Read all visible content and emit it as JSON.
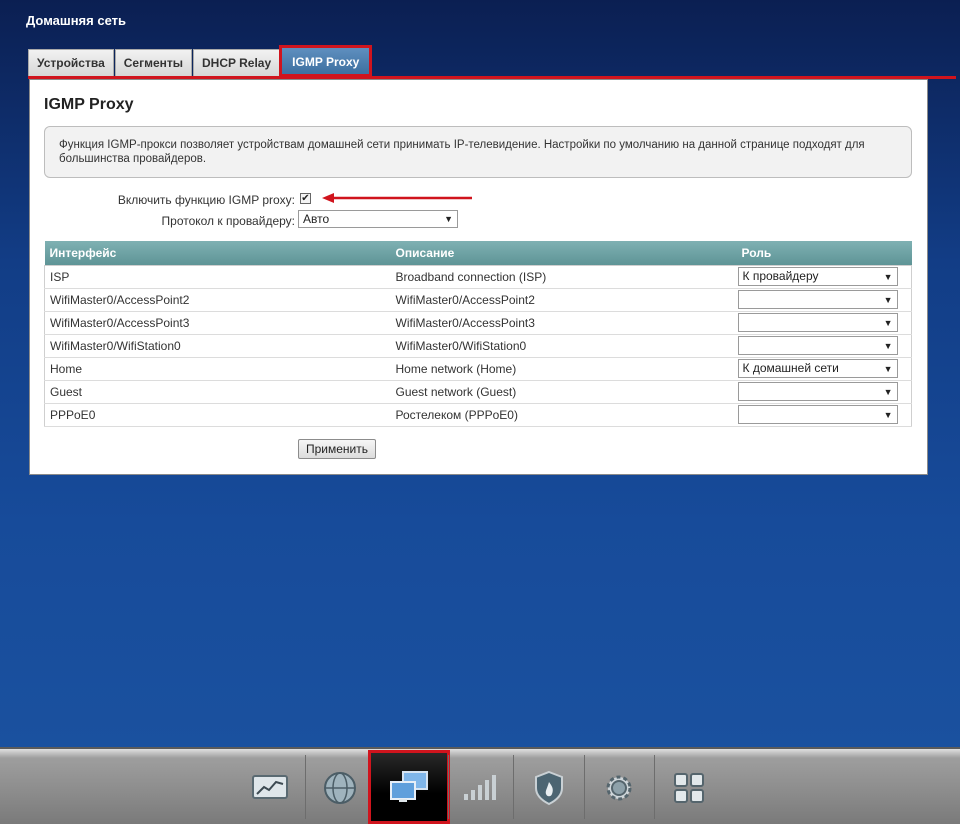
{
  "header": {
    "title": "Домашняя сеть"
  },
  "tabs": [
    {
      "label": "Устройства"
    },
    {
      "label": "Сегменты"
    },
    {
      "label": "DHCP Relay"
    },
    {
      "label": "IGMP Proxy",
      "active": true
    }
  ],
  "panel": {
    "title": "IGMP Proxy",
    "info": "Функция IGMP-прокси позволяет устройствам домашней сети принимать IP-телевидение. Настройки по умолчанию на данной странице подходят для большинства провайдеров.",
    "enable_label": "Включить функцию IGMP proxy:",
    "enable_checked": true,
    "protocol_label": "Протокол к провайдеру:",
    "protocol_value": "Авто",
    "apply_label": "Применить"
  },
  "table": {
    "headers": [
      "Интерфейс",
      "Описание",
      "Роль"
    ],
    "rows": [
      {
        "interface": "ISP",
        "description": "Broadband connection (ISP)",
        "role": "К провайдеру"
      },
      {
        "interface": "WifiMaster0/AccessPoint2",
        "description": "WifiMaster0/AccessPoint2",
        "role": ""
      },
      {
        "interface": "WifiMaster0/AccessPoint3",
        "description": "WifiMaster0/AccessPoint3",
        "role": ""
      },
      {
        "interface": "WifiMaster0/WifiStation0",
        "description": "WifiMaster0/WifiStation0",
        "role": ""
      },
      {
        "interface": "Home",
        "description": "Home network (Home)",
        "role": "К домашней сети"
      },
      {
        "interface": "Guest",
        "description": "Guest network (Guest)",
        "role": ""
      },
      {
        "interface": "PPPoE0",
        "description": "Ростелеком (PPPoE0)",
        "role": ""
      }
    ]
  },
  "bottom_nav": {
    "items": [
      {
        "icon": "monitor-chart-icon"
      },
      {
        "icon": "globe-icon"
      },
      {
        "icon": "home-network-icon",
        "active": true
      },
      {
        "icon": "wifi-signal-icon"
      },
      {
        "icon": "shield-icon"
      },
      {
        "icon": "gear-icon"
      },
      {
        "icon": "apps-grid-icon"
      }
    ]
  },
  "colors": {
    "accent_red": "#d0141d",
    "table_header": "#6fa3a5",
    "active_tab": "#4a7fb0"
  }
}
